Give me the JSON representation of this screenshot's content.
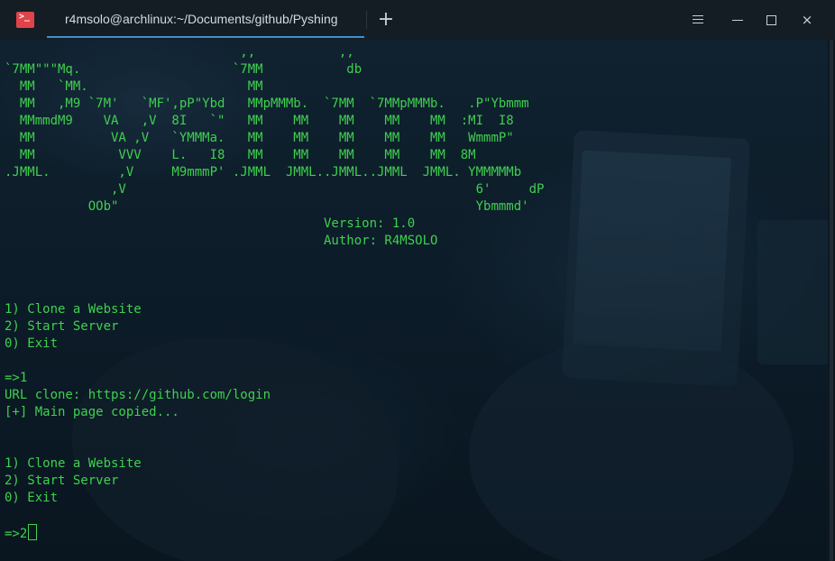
{
  "window": {
    "tab_title": "r4msolo@archlinux:~/Documents/github/Pyshing",
    "app_icon_glyph": ">_",
    "new_tab_glyph": "+",
    "close_glyph": "×",
    "accent_color": "#3e8fd0",
    "icon_color": "#e0434a"
  },
  "terminal": {
    "text_color": "#3fd04f",
    "lines": [
      "                               ,,           ,,",
      "`7MM\"\"\"Mq.                    `7MM           db",
      "  MM   `MM.                     MM",
      "  MM   ,M9 `7M'   `MF',pP\"Ybd   MMpMMMb.  `7MM  `7MMpMMMb.   .P\"Ybmmm",
      "  MMmmdM9    VA   ,V  8I   `\"   MM    MM    MM    MM    MM  :MI  I8",
      "  MM          VA ,V   `YMMMa.   MM    MM    MM    MM    MM   WmmmP\"",
      "  MM           VVV    L.   I8   MM    MM    MM    MM    MM  8M",
      ".JMML.         ,V     M9mmmP' .JMML  JMML..JMML..JMML  JMML. YMMMMMb",
      "              ,V                                              6'     dP",
      "           OOb\"                                               Ybmmmd'",
      "                                          Version: 1.0",
      "                                          Author: R4MSOLO",
      "",
      "",
      "",
      "1) Clone a Website",
      "2) Start Server",
      "0) Exit",
      "",
      "=>1",
      "URL clone: https://github.com/login",
      "[+] Main page copied...",
      "",
      "",
      "1) Clone a Website",
      "2) Start Server",
      "0) Exit",
      "",
      "=>2"
    ]
  }
}
